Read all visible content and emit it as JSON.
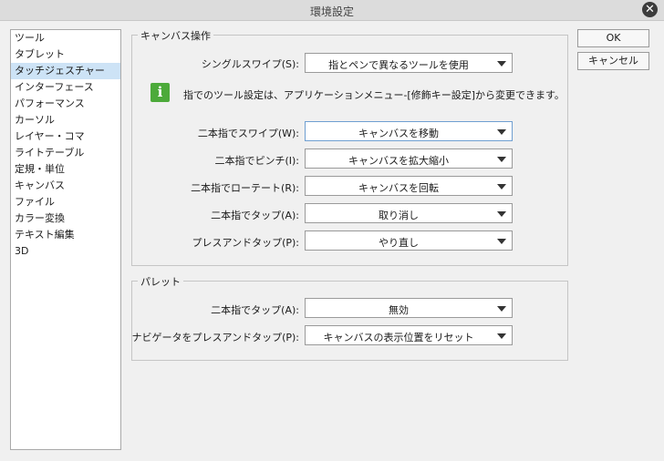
{
  "window": {
    "title": "環境設定",
    "close_glyph": "✕"
  },
  "categories": [
    {
      "label": "ツール"
    },
    {
      "label": "タブレット"
    },
    {
      "label": "タッチジェスチャー",
      "selected": true
    },
    {
      "label": "インターフェース"
    },
    {
      "label": "パフォーマンス"
    },
    {
      "label": "カーソル"
    },
    {
      "label": "レイヤー・コマ"
    },
    {
      "label": "ライトテーブル"
    },
    {
      "label": "定規・単位"
    },
    {
      "label": "キャンバス"
    },
    {
      "label": "ファイル"
    },
    {
      "label": "カラー変換"
    },
    {
      "label": "テキスト編集"
    },
    {
      "label": "3D"
    }
  ],
  "canvas_ops": {
    "legend": "キャンバス操作",
    "single_swipe": {
      "label": "シングルスワイプ(S):",
      "value": "指とペンで異なるツールを使用"
    },
    "info_glyph": "i",
    "info_text": "指でのツール設定は、アプリケーションメニュー-[修飾キー設定]から変更できます。",
    "rows": [
      {
        "label": "二本指でスワイプ(W):",
        "value": "キャンバスを移動"
      },
      {
        "label": "二本指でピンチ(I):",
        "value": "キャンバスを拡大縮小"
      },
      {
        "label": "二本指でローテート(R):",
        "value": "キャンバスを回転"
      },
      {
        "label": "二本指でタップ(A):",
        "value": "取り消し"
      },
      {
        "label": "プレスアンドタップ(P):",
        "value": "やり直し"
      }
    ]
  },
  "palette": {
    "legend": "パレット",
    "rows": [
      {
        "label": "二本指でタップ(A):",
        "value": "無効"
      },
      {
        "label": "ナビゲータをプレスアンドタップ(P):",
        "value": "キャンバスの表示位置をリセット"
      }
    ]
  },
  "buttons": {
    "ok": "OK",
    "cancel": "キャンセル"
  },
  "colors": {
    "selection": "#cde3f6",
    "info_icon": "#4caa3a",
    "focus_border": "#6f9fd1"
  }
}
